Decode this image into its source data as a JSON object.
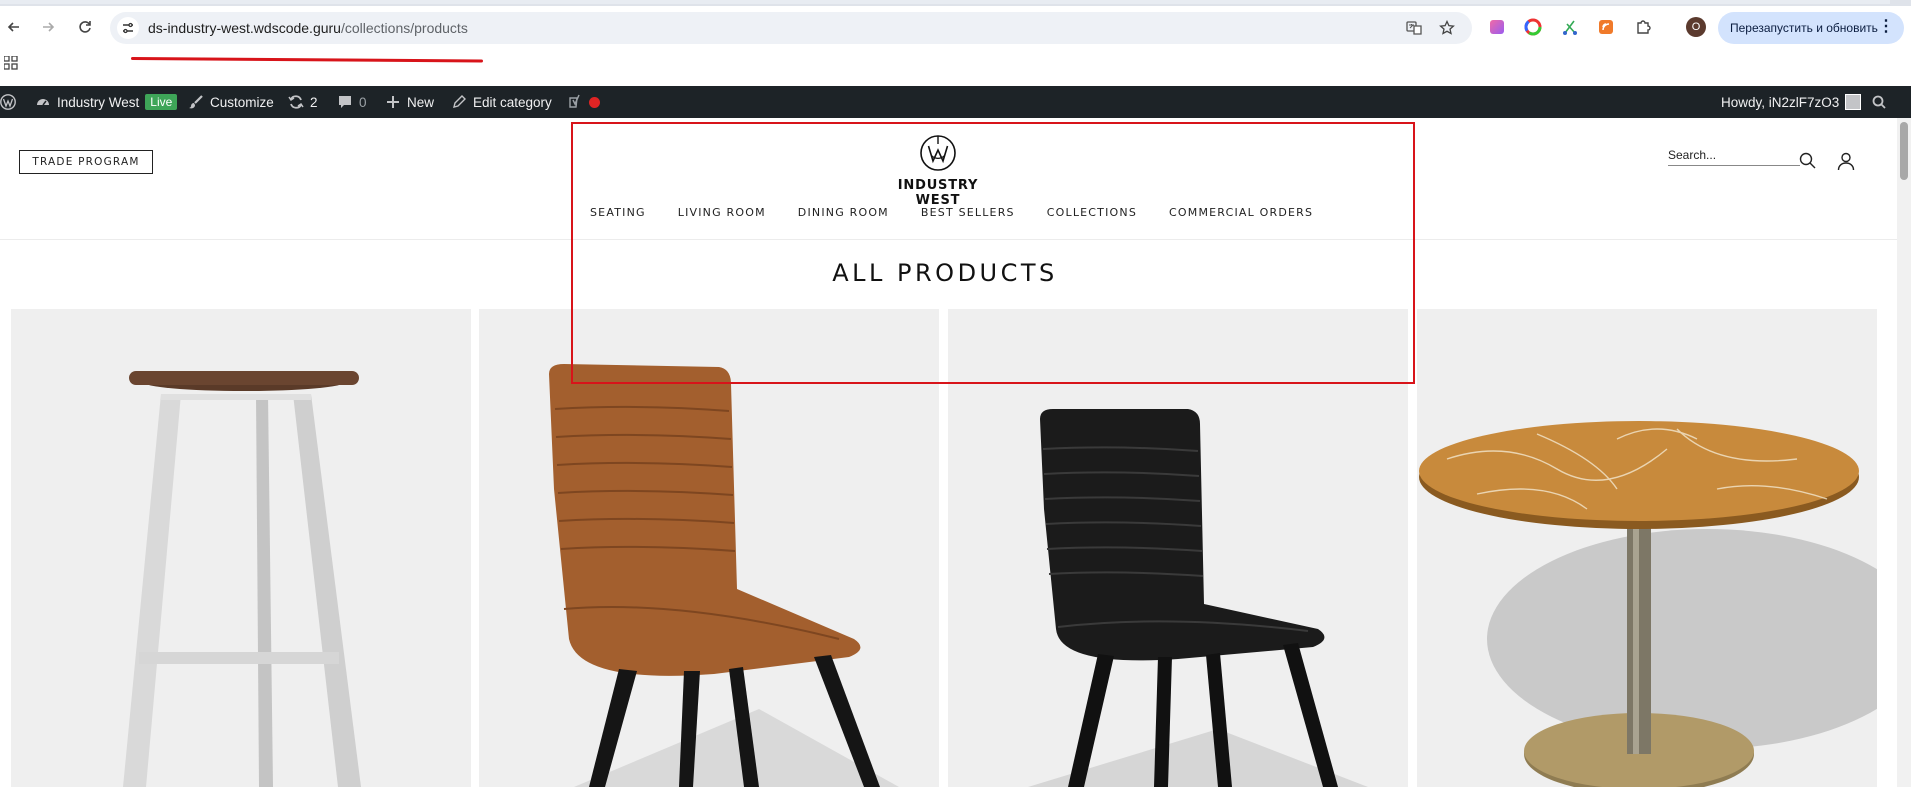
{
  "browser": {
    "url_host": "ds-industry-west.wdscode.guru",
    "url_path": "/collections/products",
    "profile_initial": "O",
    "relaunch_label": "Перезапустить и обновить",
    "menu_glyph": "⋮"
  },
  "admin_bar": {
    "site_name": "Industry West",
    "live_badge": "Live",
    "customize": "Customize",
    "updates_count": "2",
    "comments_count": "0",
    "new_label": "New",
    "edit_category": "Edit category",
    "howdy": "Howdy, iN2zlF7zO3"
  },
  "header": {
    "trade_program": "TRADE PROGRAM",
    "brand_name": "INDUSTRY WEST",
    "search_placeholder": "Search...",
    "nav": [
      "SEATING",
      "LIVING ROOM",
      "DINING ROOM",
      "BEST SELLERS",
      "COLLECTIONS",
      "COMMERCIAL ORDERS"
    ]
  },
  "page": {
    "title": "ALL PRODUCTS"
  },
  "products": [
    {
      "name": "Wood-top bar stool with white frame"
    },
    {
      "name": "Tan leather channel-stitched dining chair"
    },
    {
      "name": "Black leather channel-stitched dining chair"
    },
    {
      "name": "Round marble-top bistro table"
    }
  ],
  "colors": {
    "admin_bar": "#1d2327",
    "live_badge": "#3ea558",
    "annotation_red": "#d8141a",
    "relaunch_bg": "#d3e3fd"
  }
}
